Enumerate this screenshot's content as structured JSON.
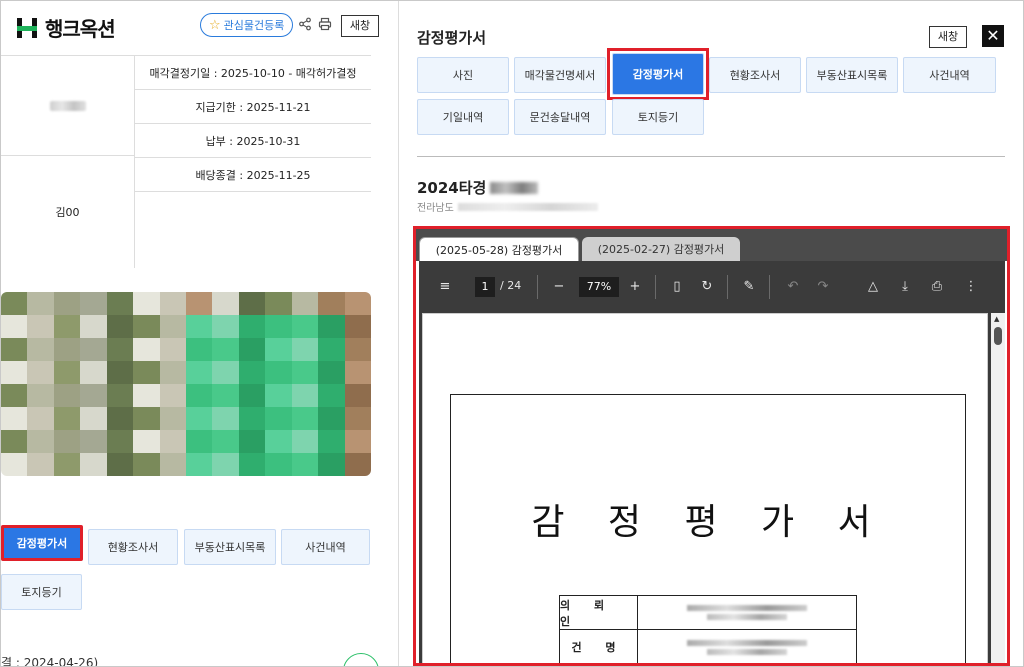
{
  "app": {
    "logo_text": "행크옥션",
    "favorite_button": "관심물건등록",
    "new_window": "새창"
  },
  "info": {
    "rows": [
      "매각결정기일 : 2025-10-10 - 매각허가결정",
      "지급기한 : 2025-11-21",
      "납부 : 2025-10-31",
      "배당종결 : 2025-11-25"
    ],
    "owner": "김00"
  },
  "left_buttons": [
    {
      "label": "감정평가서",
      "active": true
    },
    {
      "label": "현황조사서",
      "active": false
    },
    {
      "label": "부동산표시목록",
      "active": false
    },
    {
      "label": "사건내역",
      "active": false
    },
    {
      "label": "토지등기",
      "active": false
    }
  ],
  "left_bottom_text": "결 : 2024-04-26)",
  "panel": {
    "title": "감정평가서",
    "new_window": "새창",
    "close": "✕",
    "tabs": [
      {
        "label": "사진",
        "active": false
      },
      {
        "label": "매각물건명세서",
        "active": false
      },
      {
        "label": "감정평가서",
        "active": true
      },
      {
        "label": "현황조사서",
        "active": false
      },
      {
        "label": "부동산표시목록",
        "active": false
      },
      {
        "label": "사건내역",
        "active": false
      },
      {
        "label": "기일내역",
        "active": false
      },
      {
        "label": "문건송달내역",
        "active": false
      },
      {
        "label": "토지등기",
        "active": false
      }
    ],
    "case_number": "2024타경",
    "address_prefix": "전라남도"
  },
  "viewer": {
    "tabs": [
      "(2025-05-28) 감정평가서",
      "(2025-02-27) 감정평가서"
    ],
    "page_current": "1",
    "page_total": "/ 24",
    "zoom": "77%",
    "doc_title": "감 정 평 가 서",
    "doc_labels": [
      "의 뢰 인",
      "건 명"
    ]
  },
  "colors": {
    "accent_blue": "#2b77e4",
    "highlight_red": "#e0202a",
    "brand_green": "#1fb35b",
    "pdf_toolbar": "#3b3b3b"
  }
}
